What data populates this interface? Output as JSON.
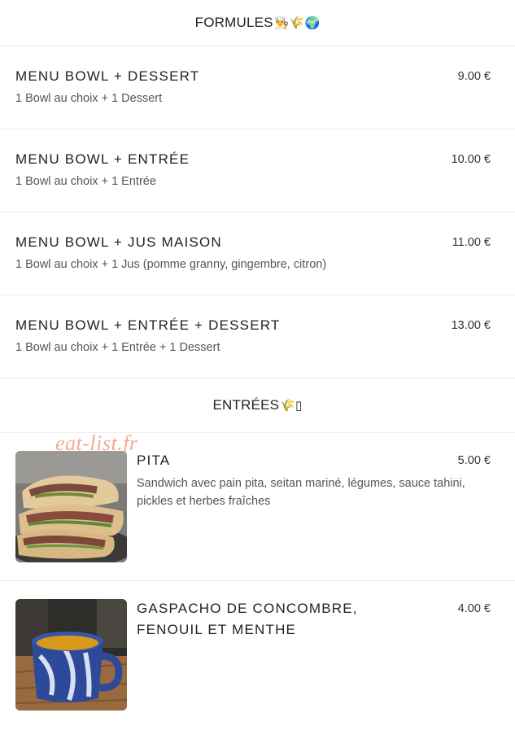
{
  "sections": {
    "formules": {
      "title": "FORMULES",
      "emoji": "👨‍🍳🌾🌍",
      "items": [
        {
          "name": "MENU BOWL + DESSERT",
          "desc": "1 Bowl au choix + 1 Dessert",
          "price": "9.00 €"
        },
        {
          "name": "MENU BOWL + ENTRÉE",
          "desc": "1 Bowl au choix + 1 Entrée",
          "price": "10.00 €"
        },
        {
          "name": "MENU BOWL + JUS MAISON",
          "desc": "1 Bowl au choix + 1 Jus (pomme granny, gingembre, citron)",
          "price": "11.00 €"
        },
        {
          "name": "MENU BOWL + ENTRÉE + DESSERT",
          "desc": "1 Bowl au choix + 1 Entrée + 1 Dessert",
          "price": "13.00 €"
        }
      ]
    },
    "entrees": {
      "title": "ENTRÉES",
      "emoji": "🌾▯",
      "items": [
        {
          "name": "PITA",
          "desc": "Sandwich avec pain pita, seitan mariné, légumes, sauce tahini, pickles et herbes fraîches",
          "price": "5.00 €",
          "image": "pita-sandwich-photo"
        },
        {
          "name": "GASPACHO DE CONCOMBRE, FENOUIL ET MENTHE",
          "desc": "",
          "price": "4.00 €",
          "image": "gaspacho-mug-photo"
        }
      ]
    }
  },
  "watermark": "eat-list.fr"
}
